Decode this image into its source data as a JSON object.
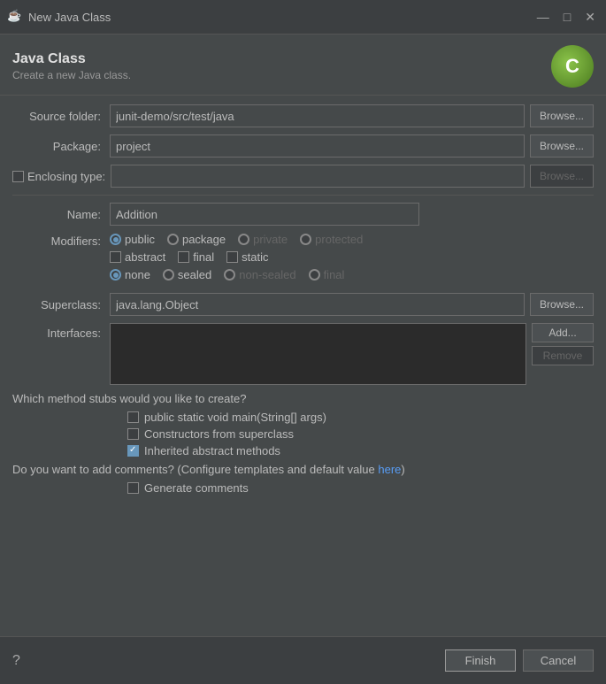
{
  "titleBar": {
    "icon": "☕",
    "title": "New Java Class",
    "minimizeBtn": "—",
    "maximizeBtn": "□",
    "closeBtn": "✕"
  },
  "header": {
    "title": "Java Class",
    "subtitle": "Create a new Java class."
  },
  "form": {
    "sourceFolderLabel": "Source folder:",
    "sourceFolderValue": "junit-demo/src/test/java",
    "packageLabel": "Package:",
    "packageValue": "project",
    "enclosingLabel": "Enclosing type:",
    "nameLabel": "Name:",
    "nameValue": "Addition",
    "modifiersLabel": "Modifiers:",
    "superclassLabel": "Superclass:",
    "superclassValue": "java.lang.Object",
    "interfacesLabel": "Interfaces:"
  },
  "modifiers": {
    "row1": [
      {
        "id": "mod-public",
        "label": "public",
        "checked": true,
        "disabled": false
      },
      {
        "id": "mod-package",
        "label": "package",
        "checked": false,
        "disabled": false
      },
      {
        "id": "mod-private",
        "label": "private",
        "checked": false,
        "disabled": true
      },
      {
        "id": "mod-protected",
        "label": "protected",
        "checked": false,
        "disabled": true
      }
    ],
    "row2": [
      {
        "id": "mod-abstract",
        "label": "abstract",
        "checked": false,
        "disabled": false
      },
      {
        "id": "mod-final",
        "label": "final",
        "checked": false,
        "disabled": false
      },
      {
        "id": "mod-static",
        "label": "static",
        "checked": false,
        "disabled": false
      }
    ],
    "row3": [
      {
        "id": "mod-none",
        "label": "none",
        "checked": true,
        "disabled": false
      },
      {
        "id": "mod-sealed",
        "label": "sealed",
        "checked": false,
        "disabled": false
      },
      {
        "id": "mod-nonsealed",
        "label": "non-sealed",
        "checked": false,
        "disabled": true
      },
      {
        "id": "mod-final2",
        "label": "final",
        "checked": false,
        "disabled": true
      }
    ]
  },
  "buttons": {
    "browse": "Browse...",
    "browseDisabled": "Browse...",
    "add": "Add...",
    "remove": "Remove",
    "finish": "Finish",
    "cancel": "Cancel"
  },
  "stubs": {
    "question": "Which method stubs would you like to create?",
    "items": [
      {
        "id": "stub-main",
        "label": "public static void main(String[] args)",
        "checked": false
      },
      {
        "id": "stub-constructors",
        "label": "Constructors from superclass",
        "checked": false
      },
      {
        "id": "stub-inherited",
        "label": "Inherited abstract methods",
        "checked": true
      }
    ]
  },
  "comments": {
    "question": "Do you want to add comments? (Configure templates and default value ",
    "link": "here",
    "questionEnd": ")",
    "items": [
      {
        "id": "comment-generate",
        "label": "Generate comments",
        "checked": false
      }
    ]
  }
}
